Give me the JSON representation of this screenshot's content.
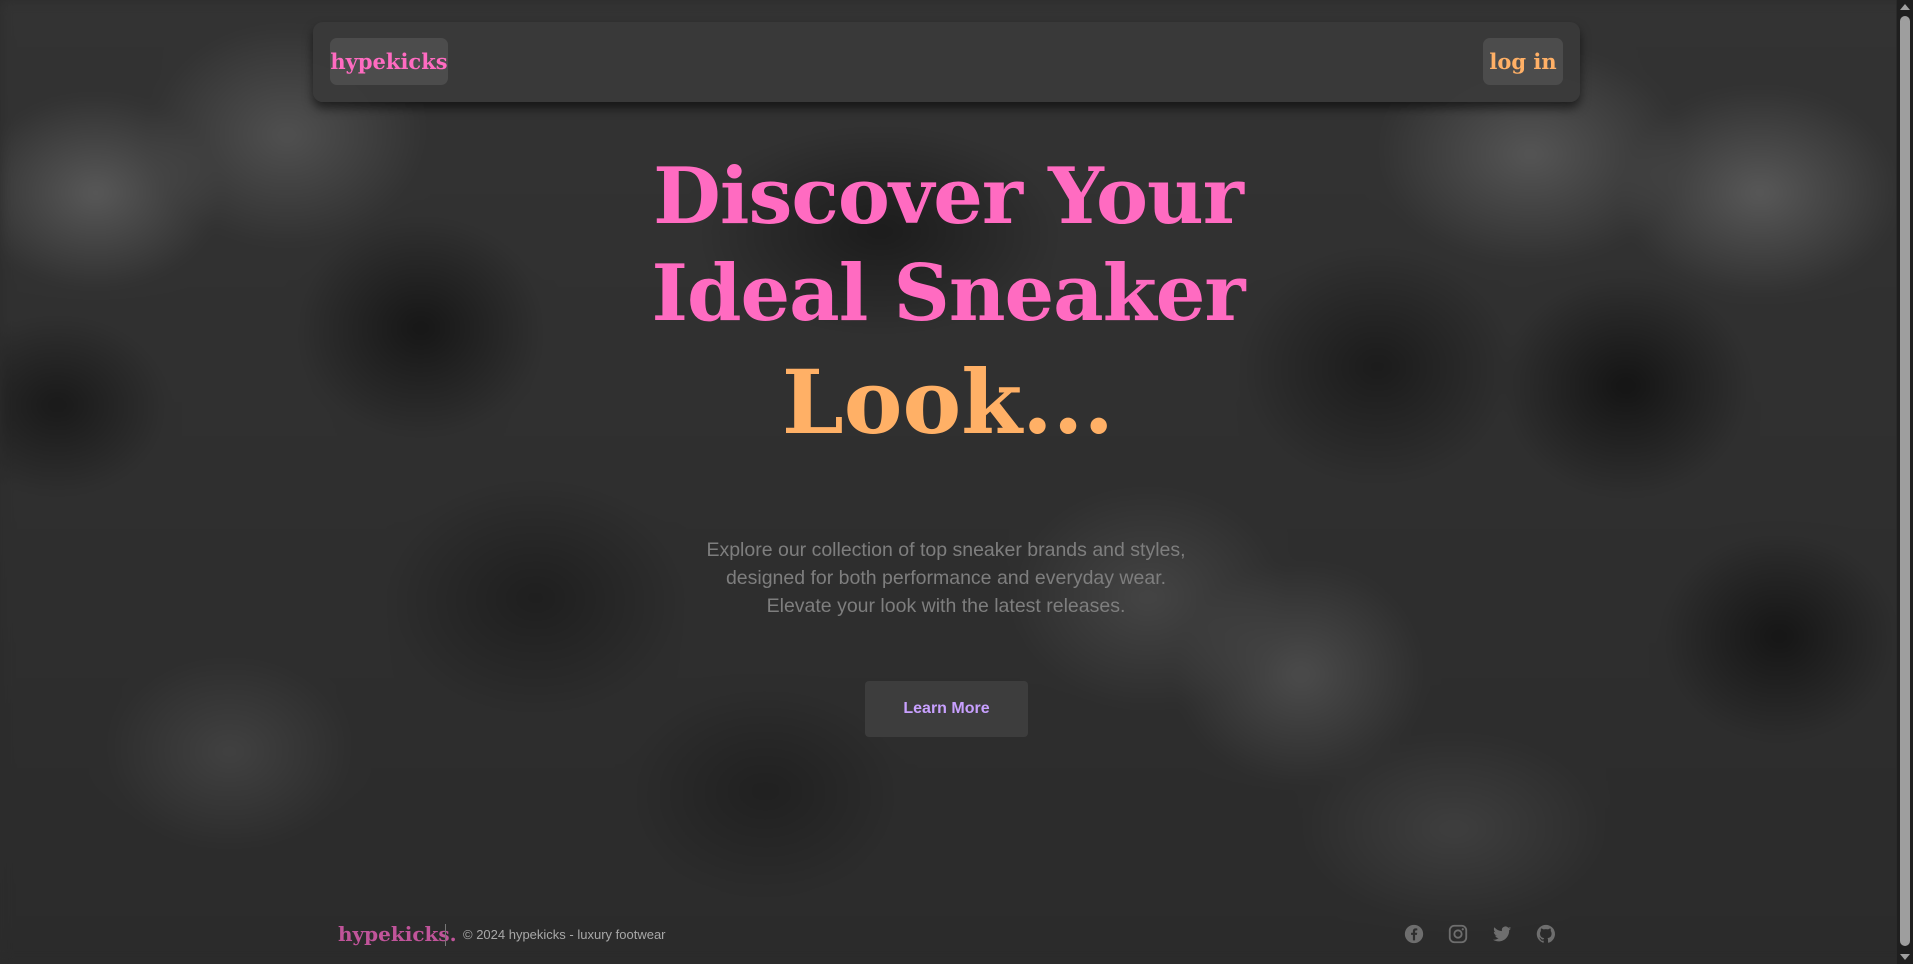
{
  "nav": {
    "logo": "hypekicks",
    "login": "log in"
  },
  "hero": {
    "title_line1": "Discover Your",
    "title_line2": "Ideal Sneaker",
    "subtitle": "Look...",
    "description": "Explore our collection of top sneaker brands and styles, designed for both performance and everyday wear. Elevate your look with the latest releases.",
    "cta": "Learn More"
  },
  "footer": {
    "logo": "hypekicks.",
    "copyright": "© 2024 hypekicks - luxury footwear",
    "socials": [
      "facebook-icon",
      "instagram-icon",
      "twitter-icon",
      "github-icon"
    ]
  },
  "colors": {
    "pink": "#ff6bc1",
    "orange": "#ffb066",
    "purple": "#c8a0ff",
    "text_muted": "#7e7e7e"
  }
}
